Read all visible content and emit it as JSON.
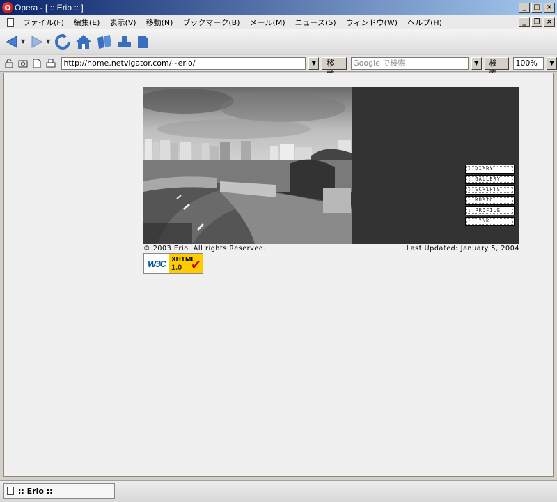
{
  "window": {
    "title": "Opera - [ :: Erio :: ]",
    "app_icon": "opera-icon",
    "controls": [
      "minimize",
      "maximize",
      "close"
    ]
  },
  "menu": {
    "items": [
      "ファイル(F)",
      "編集(E)",
      "表示(V)",
      "移動(N)",
      "ブックマーク(B)",
      "メール(M)",
      "ニュース(S)",
      "ウィンドウ(W)",
      "ヘルプ(H)"
    ]
  },
  "toolbar": {
    "buttons": [
      "back-icon",
      "forward-icon",
      "reload-icon",
      "home-icon",
      "bookmarks-icon",
      "print-icon",
      "page-icon"
    ]
  },
  "address": {
    "url": "http://home.netvigator.com/~erio/",
    "go_label": "移動",
    "search_placeholder": "Google で検索",
    "search_label": "検索",
    "zoom": "100%"
  },
  "page": {
    "nav": [
      "::DIARY",
      "::GALLERY",
      "::SCRIPTS",
      "::MUSIC",
      "::PROFILE",
      "::LINK"
    ],
    "copyright": "© 2003 Erio. All rights Reserved.",
    "last_updated": "Last Updated: January 5, 2004",
    "badge_left": "W3C",
    "badge_top": "XHTML",
    "badge_bottom": "1.0"
  },
  "status": {
    "tab_title": ":: Erio ::"
  },
  "colors": {
    "title_gradient_start": "#0a246a",
    "title_gradient_end": "#a6caf0",
    "banner_dark": "#333333",
    "badge_yellow": "#ffcc00"
  }
}
